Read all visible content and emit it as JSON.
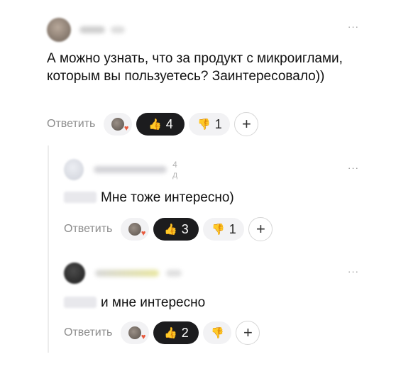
{
  "comments": [
    {
      "time": "",
      "text": "А можно узнать, что за продукт с микроиглами, которым вы пользуетесь? Заинтересовало))",
      "reply_label": "Ответить",
      "likes": "4",
      "dislikes": "1",
      "more": "···"
    },
    {
      "time": "4 д",
      "text": "Мне тоже интересно)",
      "reply_label": "Ответить",
      "likes": "3",
      "dislikes": "1",
      "more": "···"
    },
    {
      "time": "",
      "text": "и мне интересно",
      "reply_label": "Ответить",
      "likes": "2",
      "more": "···"
    }
  ],
  "icons": {
    "like": "thumbs-up-icon",
    "dislike": "thumbs-down-icon",
    "add": "plus-icon",
    "more": "more-icon"
  },
  "colors": {
    "dark_pill": "#1c1c1e",
    "light_pill": "#f2f2f4",
    "muted_text": "#8c8c8c"
  }
}
